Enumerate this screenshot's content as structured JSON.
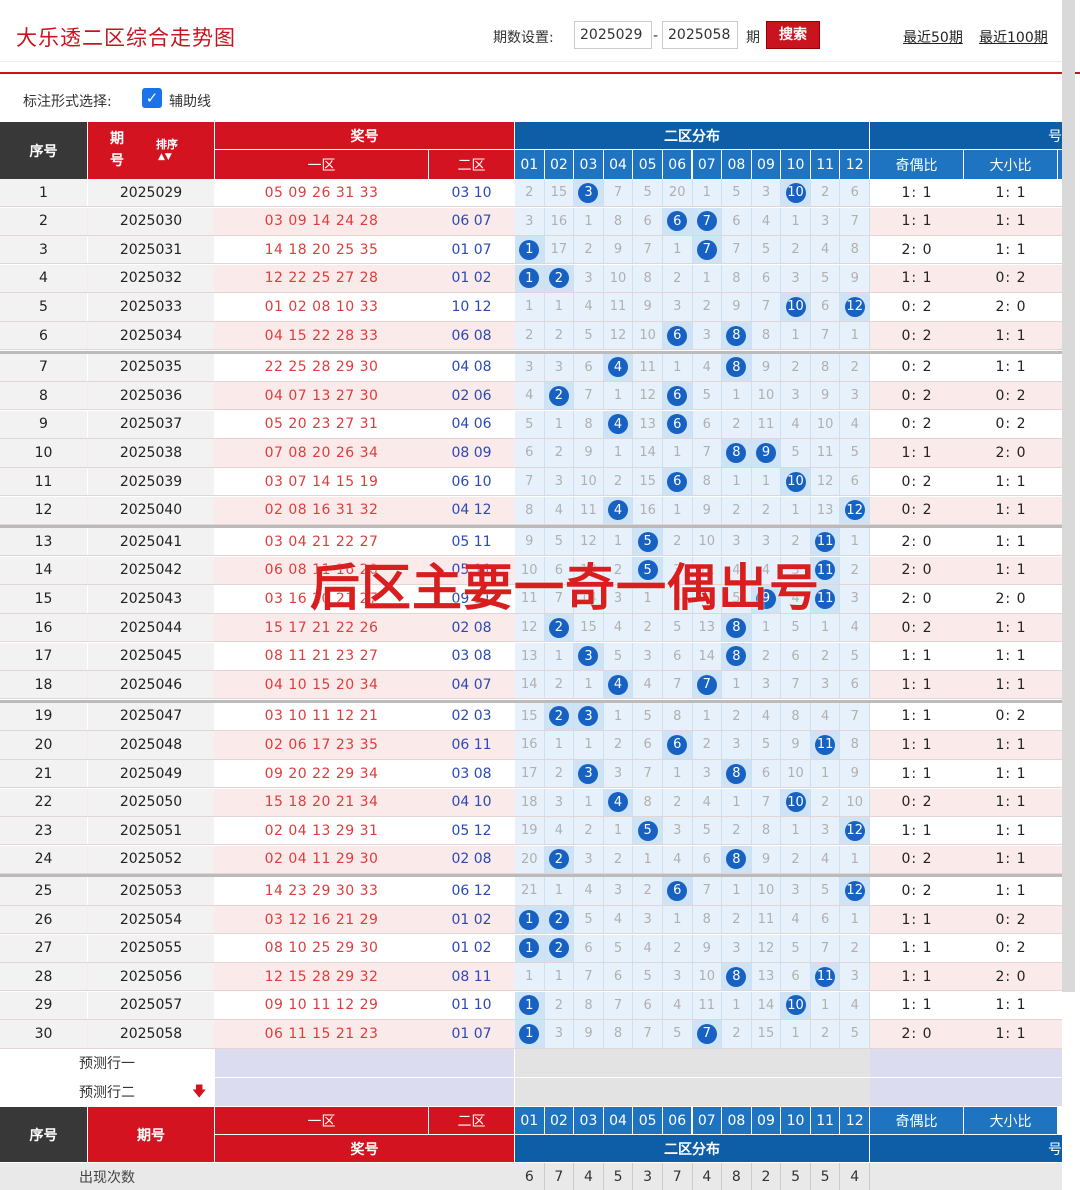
{
  "header": {
    "title": "大乐透二区综合走势图",
    "period_label": "期数设置:",
    "start_period": "2025029",
    "dash": "-",
    "end_period": "2025058",
    "period_unit": "期",
    "search_label": "搜索",
    "recent50": "最近50期",
    "recent100": "最近100期"
  },
  "options": {
    "label": "标注形式选择:",
    "checkbox_label": "辅助线",
    "checked": true
  },
  "table_header": {
    "index": "序号",
    "issue": "期号",
    "sort": "排序",
    "prize": "奖号",
    "zone1": "一区",
    "zone2": "二区",
    "dist_title": "二区分布",
    "odd_even": "奇偶比",
    "big_small": "大小比",
    "cut": "号",
    "dist_cols": [
      "01",
      "02",
      "03",
      "04",
      "05",
      "06",
      "07",
      "08",
      "09",
      "10",
      "11",
      "12"
    ]
  },
  "rows": [
    {
      "idx": "1",
      "issue": "2025029",
      "z1": "05 09 26 31 33",
      "z2": "03 10",
      "miss": [
        "2",
        "15",
        "3",
        "7",
        "5",
        "20",
        "1",
        "5",
        "3",
        "10",
        "2",
        "6"
      ],
      "hits": [
        3,
        10
      ],
      "oe": "1: 1",
      "bs": "1: 1"
    },
    {
      "idx": "2",
      "issue": "2025030",
      "z1": "03 09 14 24 28",
      "z2": "06 07",
      "miss": [
        "3",
        "16",
        "1",
        "8",
        "6",
        "6",
        "7",
        "6",
        "4",
        "1",
        "3",
        "7"
      ],
      "hits": [
        6,
        7
      ],
      "oe": "1: 1",
      "bs": "1: 1"
    },
    {
      "idx": "3",
      "issue": "2025031",
      "z1": "14 18 20 25 35",
      "z2": "01 07",
      "miss": [
        "1",
        "17",
        "2",
        "9",
        "7",
        "1",
        "7",
        "7",
        "5",
        "2",
        "4",
        "8"
      ],
      "hits": [
        1,
        7
      ],
      "oe": "2: 0",
      "bs": "1: 1"
    },
    {
      "idx": "4",
      "issue": "2025032",
      "z1": "12 22 25 27 28",
      "z2": "01 02",
      "miss": [
        "1",
        "2",
        "3",
        "10",
        "8",
        "2",
        "1",
        "8",
        "6",
        "3",
        "5",
        "9"
      ],
      "hits": [
        1,
        2
      ],
      "oe": "1: 1",
      "bs": "0: 2"
    },
    {
      "idx": "5",
      "issue": "2025033",
      "z1": "01 02 08 10 33",
      "z2": "10 12",
      "miss": [
        "1",
        "1",
        "4",
        "11",
        "9",
        "3",
        "2",
        "9",
        "7",
        "10",
        "6",
        "12"
      ],
      "hits": [
        10,
        12
      ],
      "oe": "0: 2",
      "bs": "2: 0"
    },
    {
      "idx": "6",
      "issue": "2025034",
      "z1": "04 15 22 28 33",
      "z2": "06 08",
      "miss": [
        "2",
        "2",
        "5",
        "12",
        "10",
        "6",
        "3",
        "8",
        "8",
        "1",
        "7",
        "1"
      ],
      "hits": [
        6,
        8
      ],
      "oe": "0: 2",
      "bs": "1: 1"
    },
    {
      "idx": "7",
      "issue": "2025035",
      "z1": "22 25 28 29 30",
      "z2": "04 08",
      "miss": [
        "3",
        "3",
        "6",
        "4",
        "11",
        "1",
        "4",
        "8",
        "9",
        "2",
        "8",
        "2"
      ],
      "hits": [
        4,
        8
      ],
      "oe": "0: 2",
      "bs": "1: 1"
    },
    {
      "idx": "8",
      "issue": "2025036",
      "z1": "04 07 13 27 30",
      "z2": "02 06",
      "miss": [
        "4",
        "2",
        "7",
        "1",
        "12",
        "6",
        "5",
        "1",
        "10",
        "3",
        "9",
        "3"
      ],
      "hits": [
        2,
        6
      ],
      "oe": "0: 2",
      "bs": "0: 2"
    },
    {
      "idx": "9",
      "issue": "2025037",
      "z1": "05 20 23 27 31",
      "z2": "04 06",
      "miss": [
        "5",
        "1",
        "8",
        "4",
        "13",
        "6",
        "6",
        "2",
        "11",
        "4",
        "10",
        "4"
      ],
      "hits": [
        4,
        6
      ],
      "oe": "0: 2",
      "bs": "0: 2"
    },
    {
      "idx": "10",
      "issue": "2025038",
      "z1": "07 08 20 26 34",
      "z2": "08 09",
      "miss": [
        "6",
        "2",
        "9",
        "1",
        "14",
        "1",
        "7",
        "8",
        "9",
        "5",
        "11",
        "5"
      ],
      "hits": [
        8,
        9
      ],
      "oe": "1: 1",
      "bs": "2: 0"
    },
    {
      "idx": "11",
      "issue": "2025039",
      "z1": "03 07 14 15 19",
      "z2": "06 10",
      "miss": [
        "7",
        "3",
        "10",
        "2",
        "15",
        "6",
        "8",
        "1",
        "1",
        "10",
        "12",
        "6"
      ],
      "hits": [
        6,
        10
      ],
      "oe": "0: 2",
      "bs": "1: 1"
    },
    {
      "idx": "12",
      "issue": "2025040",
      "z1": "02 08 16 31 32",
      "z2": "04 12",
      "miss": [
        "8",
        "4",
        "11",
        "4",
        "16",
        "1",
        "9",
        "2",
        "2",
        "1",
        "13",
        "12"
      ],
      "hits": [
        4,
        12
      ],
      "oe": "0: 2",
      "bs": "1: 1"
    },
    {
      "idx": "13",
      "issue": "2025041",
      "z1": "03 04 21 22 27",
      "z2": "05 11",
      "miss": [
        "9",
        "5",
        "12",
        "1",
        "5",
        "2",
        "10",
        "3",
        "3",
        "2",
        "11",
        "1"
      ],
      "hits": [
        5,
        11
      ],
      "oe": "2: 0",
      "bs": "1: 1"
    },
    {
      "idx": "14",
      "issue": "2025042",
      "z1": "06 08 11 16 20",
      "z2": "05 11",
      "miss": [
        "10",
        "6",
        "13",
        "2",
        "5",
        "3",
        "11",
        "4",
        "4",
        "3",
        "11",
        "2"
      ],
      "hits": [
        5,
        11
      ],
      "oe": "2: 0",
      "bs": "1: 1"
    },
    {
      "idx": "15",
      "issue": "2025043",
      "z1": "03 16 20 21 27",
      "z2": "09 11",
      "miss": [
        "11",
        "7",
        "14",
        "3",
        "1",
        "4",
        "12",
        "5",
        "9",
        "4",
        "11",
        "3"
      ],
      "hits": [
        9,
        11
      ],
      "oe": "2: 0",
      "bs": "2: 0"
    },
    {
      "idx": "16",
      "issue": "2025044",
      "z1": "15 17 21 22 26",
      "z2": "02 08",
      "miss": [
        "12",
        "2",
        "15",
        "4",
        "2",
        "5",
        "13",
        "8",
        "1",
        "5",
        "1",
        "4"
      ],
      "hits": [
        2,
        8
      ],
      "oe": "0: 2",
      "bs": "1: 1"
    },
    {
      "idx": "17",
      "issue": "2025045",
      "z1": "08 11 21 23 27",
      "z2": "03 08",
      "miss": [
        "13",
        "1",
        "3",
        "5",
        "3",
        "6",
        "14",
        "8",
        "2",
        "6",
        "2",
        "5"
      ],
      "hits": [
        3,
        8
      ],
      "oe": "1: 1",
      "bs": "1: 1"
    },
    {
      "idx": "18",
      "issue": "2025046",
      "z1": "04 10 15 20 34",
      "z2": "04 07",
      "miss": [
        "14",
        "2",
        "1",
        "4",
        "4",
        "7",
        "7",
        "1",
        "3",
        "7",
        "3",
        "6"
      ],
      "hits": [
        4,
        7
      ],
      "oe": "1: 1",
      "bs": "1: 1"
    },
    {
      "idx": "19",
      "issue": "2025047",
      "z1": "03 10 11 12 21",
      "z2": "02 03",
      "miss": [
        "15",
        "2",
        "3",
        "1",
        "5",
        "8",
        "1",
        "2",
        "4",
        "8",
        "4",
        "7"
      ],
      "hits": [
        2,
        3
      ],
      "oe": "1: 1",
      "bs": "0: 2"
    },
    {
      "idx": "20",
      "issue": "2025048",
      "z1": "02 06 17 23 35",
      "z2": "06 11",
      "miss": [
        "16",
        "1",
        "1",
        "2",
        "6",
        "6",
        "2",
        "3",
        "5",
        "9",
        "11",
        "8"
      ],
      "hits": [
        6,
        11
      ],
      "oe": "1: 1",
      "bs": "1: 1"
    },
    {
      "idx": "21",
      "issue": "2025049",
      "z1": "09 20 22 29 34",
      "z2": "03 08",
      "miss": [
        "17",
        "2",
        "3",
        "3",
        "7",
        "1",
        "3",
        "8",
        "6",
        "10",
        "1",
        "9"
      ],
      "hits": [
        3,
        8
      ],
      "oe": "1: 1",
      "bs": "1: 1"
    },
    {
      "idx": "22",
      "issue": "2025050",
      "z1": "15 18 20 21 34",
      "z2": "04 10",
      "miss": [
        "18",
        "3",
        "1",
        "4",
        "8",
        "2",
        "4",
        "1",
        "7",
        "10",
        "2",
        "10"
      ],
      "hits": [
        4,
        10
      ],
      "oe": "0: 2",
      "bs": "1: 1"
    },
    {
      "idx": "23",
      "issue": "2025051",
      "z1": "02 04 13 29 31",
      "z2": "05 12",
      "miss": [
        "19",
        "4",
        "2",
        "1",
        "5",
        "3",
        "5",
        "2",
        "8",
        "1",
        "3",
        "12"
      ],
      "hits": [
        5,
        12
      ],
      "oe": "1: 1",
      "bs": "1: 1"
    },
    {
      "idx": "24",
      "issue": "2025052",
      "z1": "02 04 11 29 30",
      "z2": "02 08",
      "miss": [
        "20",
        "2",
        "3",
        "2",
        "1",
        "4",
        "6",
        "8",
        "9",
        "2",
        "4",
        "1"
      ],
      "hits": [
        2,
        8
      ],
      "oe": "0: 2",
      "bs": "1: 1"
    },
    {
      "idx": "25",
      "issue": "2025053",
      "z1": "14 23 29 30 33",
      "z2": "06 12",
      "miss": [
        "21",
        "1",
        "4",
        "3",
        "2",
        "6",
        "7",
        "1",
        "10",
        "3",
        "5",
        "12"
      ],
      "hits": [
        6,
        12
      ],
      "oe": "0: 2",
      "bs": "1: 1"
    },
    {
      "idx": "26",
      "issue": "2025054",
      "z1": "03 12 16 21 29",
      "z2": "01 02",
      "miss": [
        "1",
        "2",
        "5",
        "4",
        "3",
        "1",
        "8",
        "2",
        "11",
        "4",
        "6",
        "1"
      ],
      "hits": [
        1,
        2
      ],
      "oe": "1: 1",
      "bs": "0: 2"
    },
    {
      "idx": "27",
      "issue": "2025055",
      "z1": "08 10 25 29 30",
      "z2": "01 02",
      "miss": [
        "1",
        "2",
        "6",
        "5",
        "4",
        "2",
        "9",
        "3",
        "12",
        "5",
        "7",
        "2"
      ],
      "hits": [
        1,
        2
      ],
      "oe": "1: 1",
      "bs": "0: 2"
    },
    {
      "idx": "28",
      "issue": "2025056",
      "z1": "12 15 28 29 32",
      "z2": "08 11",
      "miss": [
        "1",
        "1",
        "7",
        "6",
        "5",
        "3",
        "10",
        "8",
        "13",
        "6",
        "11",
        "3"
      ],
      "hits": [
        8,
        11
      ],
      "oe": "1: 1",
      "bs": "2: 0"
    },
    {
      "idx": "29",
      "issue": "2025057",
      "z1": "09 10 11 12 29",
      "z2": "01 10",
      "miss": [
        "1",
        "2",
        "8",
        "7",
        "6",
        "4",
        "11",
        "1",
        "14",
        "10",
        "1",
        "4"
      ],
      "hits": [
        1,
        10
      ],
      "oe": "1: 1",
      "bs": "1: 1"
    },
    {
      "idx": "30",
      "issue": "2025058",
      "z1": "06 11 15 21 23",
      "z2": "01 07",
      "miss": [
        "1",
        "3",
        "9",
        "8",
        "7",
        "5",
        "7",
        "2",
        "15",
        "1",
        "2",
        "5"
      ],
      "hits": [
        1,
        7
      ],
      "oe": "2: 0",
      "bs": "1: 1"
    }
  ],
  "predict": {
    "row1": "预测行一",
    "row2": "预测行二"
  },
  "footer": {
    "count_label": "出现次数",
    "counts": [
      "6",
      "7",
      "4",
      "5",
      "3",
      "7",
      "4",
      "8",
      "2",
      "5",
      "5",
      "4"
    ]
  },
  "overlay_text": "后区主要一奇一偶出号",
  "colors": {
    "brand_red": "#d3131f",
    "ball_blue": "#1761c3",
    "dist_bg": "#e6f1fb",
    "header_blue": "#1f74c1"
  }
}
